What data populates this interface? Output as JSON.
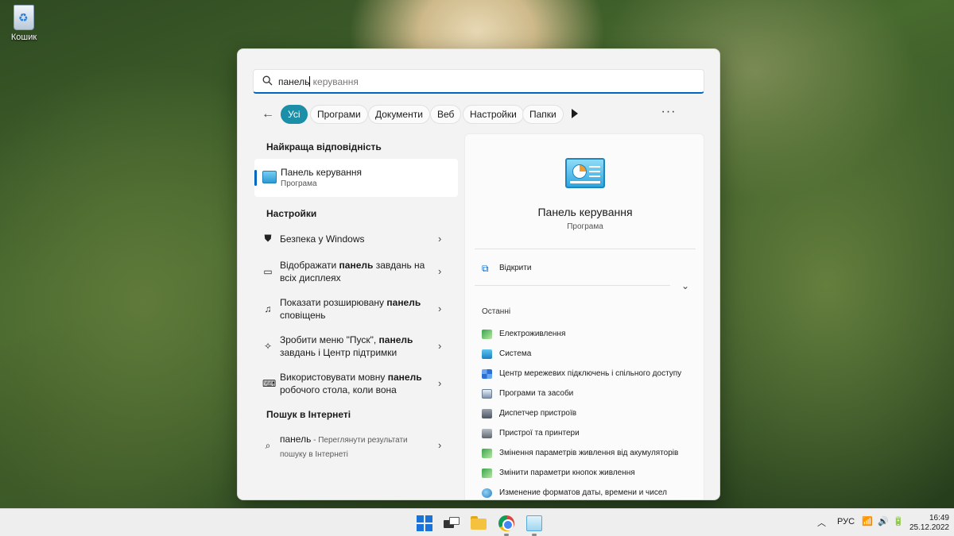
{
  "desktop": {
    "recycle_bin_label": "Кошик"
  },
  "search": {
    "typed": "панель",
    "completion": " керування"
  },
  "filters": {
    "chips": [
      "Усі",
      "Програми",
      "Документи",
      "Веб",
      "Настройки",
      "Папки"
    ]
  },
  "left": {
    "best_title": "Найкраща відповідність",
    "best_match": {
      "name": "Панель керування",
      "type": "Програма"
    },
    "settings_title": "Настройки",
    "settings_items": [
      {
        "pre": "Безпека у Windows",
        "bold": "",
        "post": ""
      },
      {
        "pre": "Відображати ",
        "bold": "панель",
        "post": " завдань на всіх дисплеях"
      },
      {
        "pre": "Показати розширювану ",
        "bold": "панель",
        "post": " сповіщень"
      },
      {
        "pre": "Зробити меню \"Пуск\", ",
        "bold": "панель",
        "post": " завдань і Центр підтримки"
      },
      {
        "pre": "Використовувати мовну ",
        "bold": "панель",
        "post": " робочого стола, коли вона"
      }
    ],
    "web_title": "Пошук в Інтернеті",
    "web_item": {
      "query": "панель",
      "hint": " - Переглянути результати пошуку в Інтернеті"
    }
  },
  "right": {
    "app_name": "Панель керування",
    "app_type": "Програма",
    "open_label": "Відкрити",
    "recent_title": "Останні",
    "recent_items": [
      "Електроживлення",
      "Система",
      "Центр мережевих підключень і спільного доступу",
      "Програми та засоби",
      "Диспетчер пристроїв",
      "Пристрої та принтери",
      "Змінення параметрів живлення від акумуляторів",
      "Змінити параметри кнопок живлення",
      "Изменение форматов даты, времени и чисел"
    ]
  },
  "taskbar": {
    "lang": "РУС",
    "time": "16:49",
    "date": "25.12.2022"
  },
  "colors": {
    "accent": "#0067c0",
    "chip_active": "#1b8ea8"
  }
}
